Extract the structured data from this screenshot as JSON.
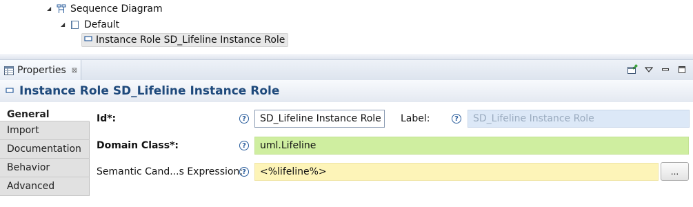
{
  "tree": {
    "items": [
      {
        "label": "Sequence Diagram",
        "icon": "sequence-diagram-icon"
      },
      {
        "label": "Default",
        "icon": "layer-icon"
      },
      {
        "label": "Instance Role SD_Lifeline Instance Role",
        "icon": "instance-role-icon",
        "selected": true
      }
    ]
  },
  "view": {
    "tab_label": "Properties",
    "close_glyph": "⊠",
    "tools": [
      "pin-icon",
      "view-menu-icon",
      "minimize-icon",
      "maximize-icon"
    ]
  },
  "title": "Instance Role SD_Lifeline Instance Role",
  "section_tabs": [
    "General",
    "Import",
    "Documentation",
    "Behavior",
    "Advanced"
  ],
  "form": {
    "id_label": "Id*:",
    "id_value": "SD_Lifeline Instance Role",
    "label_label": "Label:",
    "label_value": "SD_Lifeline Instance Role",
    "domain_class_label": "Domain Class*:",
    "domain_class_value": "uml.Lifeline",
    "semantic_label": "Semantic Cand...s Expression:",
    "semantic_value": "<%lifeline%>",
    "browse_label": "...",
    "help_glyph": "?"
  },
  "colors": {
    "title": "#1f4a7c",
    "required_field": "#cfeea0",
    "expression_field": "#fdf4b8",
    "disabled_field": "#dce8f7",
    "help": "#2a5d9c"
  }
}
